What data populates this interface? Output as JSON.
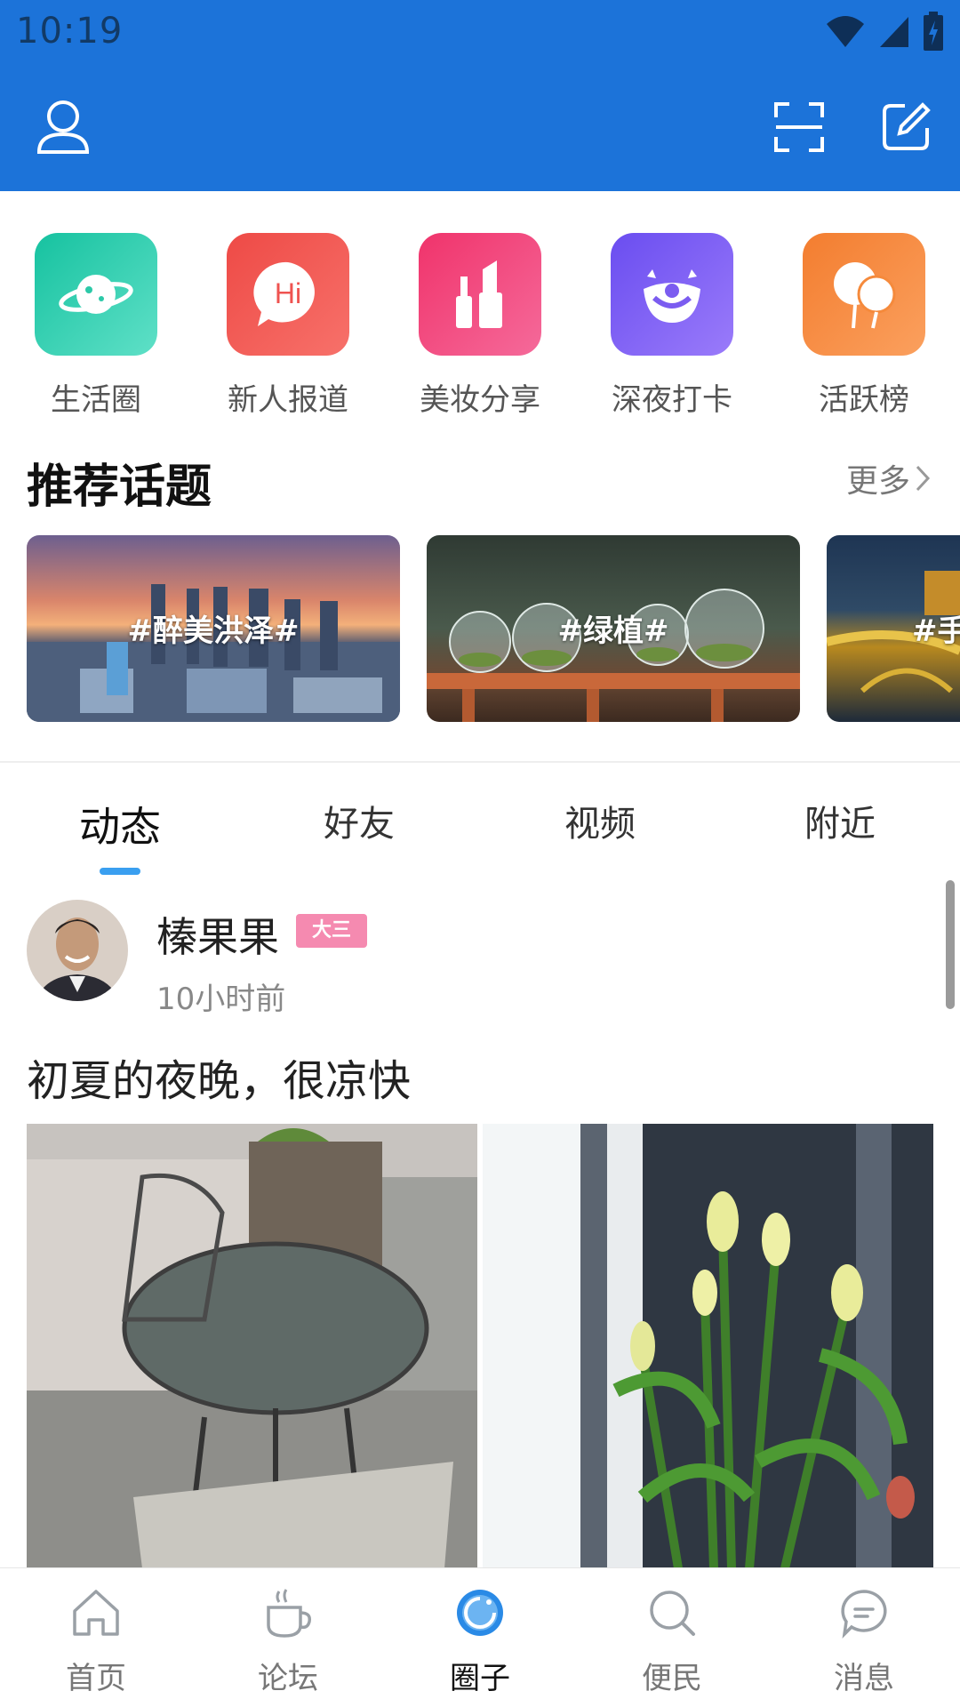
{
  "status_bar": {
    "time": "10:19",
    "icons": [
      "wifi-icon",
      "signal-icon",
      "battery-icon"
    ]
  },
  "header": {
    "left_icon": "user-icon",
    "right_icons": [
      "scan-icon",
      "compose-icon"
    ]
  },
  "colors": {
    "brand_blue": "#1c73d9",
    "tab_indicator": "#3a9ff0",
    "badge_pink": "#f58ab0"
  },
  "quick_entries": [
    {
      "label": "生活圈",
      "icon": "planet-icon",
      "color": "#22c6a7"
    },
    {
      "label": "新人报道",
      "icon": "hi-bubble-icon",
      "color": "#ef5350"
    },
    {
      "label": "美妆分享",
      "icon": "lipstick-icon",
      "color": "#f0457a"
    },
    {
      "label": "深夜打卡",
      "icon": "clown-icon",
      "color": "#7b5cf0"
    },
    {
      "label": "活跃榜",
      "icon": "balloons-icon",
      "color": "#f58a3c"
    }
  ],
  "topics_section": {
    "title": "推荐话题",
    "more_label": "更多",
    "items": [
      {
        "label": "#醉美洪泽#"
      },
      {
        "label": "#绿植#"
      },
      {
        "label": "#手"
      }
    ]
  },
  "feed_tabs": [
    {
      "label": "动态",
      "active": true
    },
    {
      "label": "好友",
      "active": false
    },
    {
      "label": "视频",
      "active": false
    },
    {
      "label": "附近",
      "active": false
    }
  ],
  "post": {
    "username": "榛果果",
    "badge": "大三",
    "time": "10小时前",
    "text": "初夏的夜晚，很凉快"
  },
  "bottom_nav": [
    {
      "label": "首页",
      "icon": "home-icon",
      "active": false
    },
    {
      "label": "论坛",
      "icon": "coffee-cup-icon",
      "active": false
    },
    {
      "label": "圈子",
      "icon": "circle-icon",
      "active": true
    },
    {
      "label": "便民",
      "icon": "search-icon",
      "active": false
    },
    {
      "label": "消息",
      "icon": "message-icon",
      "active": false
    }
  ]
}
